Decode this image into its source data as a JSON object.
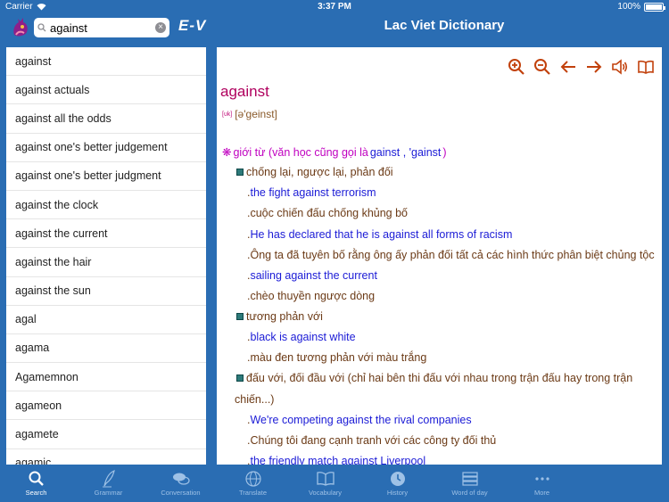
{
  "status": {
    "carrier": "Carrier",
    "time": "3:37 PM",
    "battery": "100%"
  },
  "header": {
    "search_value": "against",
    "lang_switch": "E-V",
    "title": "Lac Viet Dictionary"
  },
  "word_list": [
    "against",
    "against actuals",
    "against all the odds",
    "against one's better judgement",
    "against one's better judgment",
    "against the clock",
    "against the current",
    "against the hair",
    "against the sun",
    "agal",
    "agama",
    "Agamemnon",
    "agameon",
    "agamete",
    "agamic"
  ],
  "entry": {
    "headword": "against",
    "pron_tag": "[ᴜk]",
    "pronunciation": "[ə'geinst]",
    "pos_prefix": "giới từ (văn học cũng gọi là",
    "pos_alt": "gainst , 'gainst",
    "pos_suffix": ")",
    "lines": [
      {
        "kind": "sense",
        "text": "chống lại, ngược lại, phản đối"
      },
      {
        "kind": "ex",
        "text": "the fight against terrorism"
      },
      {
        "kind": "tr",
        "text": "cuộc chiến đấu chống khủng bố"
      },
      {
        "kind": "ex",
        "text": "He has declared that he is against all forms of racism"
      },
      {
        "kind": "tr",
        "text": "Ông ta đã tuyên bố rằng ông ấy phản đối tất cả các hình thức phân biệt chủng tộc"
      },
      {
        "kind": "ex",
        "text": "sailing against the current"
      },
      {
        "kind": "tr",
        "text": "chèo thuyền ngược dòng"
      },
      {
        "kind": "sense",
        "text": "tương phản với"
      },
      {
        "kind": "ex",
        "text": "black is against white"
      },
      {
        "kind": "tr",
        "text": "màu đen tương phản với màu trắng"
      },
      {
        "kind": "sense",
        "text": "đấu với, đối đầu với (chỉ hai bên thi đấu với nhau trong trận đấu hay trong trận"
      },
      {
        "kind": "cont",
        "text": "chiến...)"
      },
      {
        "kind": "ex",
        "text": "We're competing against the rival companies"
      },
      {
        "kind": "tr",
        "text": "Chúng tôi đang cạnh tranh với các công ty đối thủ"
      },
      {
        "kind": "ex",
        "text": "the friendly match against Liverpool"
      }
    ]
  },
  "tabs": [
    {
      "label": "Search",
      "icon": "search-icon",
      "active": true
    },
    {
      "label": "Grammar",
      "icon": "quill-icon",
      "active": false
    },
    {
      "label": "Conversation",
      "icon": "chat-bubbles-icon",
      "active": false
    },
    {
      "label": "Translate",
      "icon": "globe-icon",
      "active": false
    },
    {
      "label": "Vocabulary",
      "icon": "open-book-icon",
      "active": false
    },
    {
      "label": "History",
      "icon": "history-icon",
      "active": false
    },
    {
      "label": "Word of day",
      "icon": "stack-icon",
      "active": false
    },
    {
      "label": "More",
      "icon": "more-dots-icon",
      "active": false
    }
  ],
  "colors": {
    "bar": "#2a6db3",
    "headword": "#b0005e",
    "example": "#1b1bd6",
    "translation": "#6b3a16",
    "pos": "#c000c0",
    "toolbar_icon": "#c2410c"
  }
}
